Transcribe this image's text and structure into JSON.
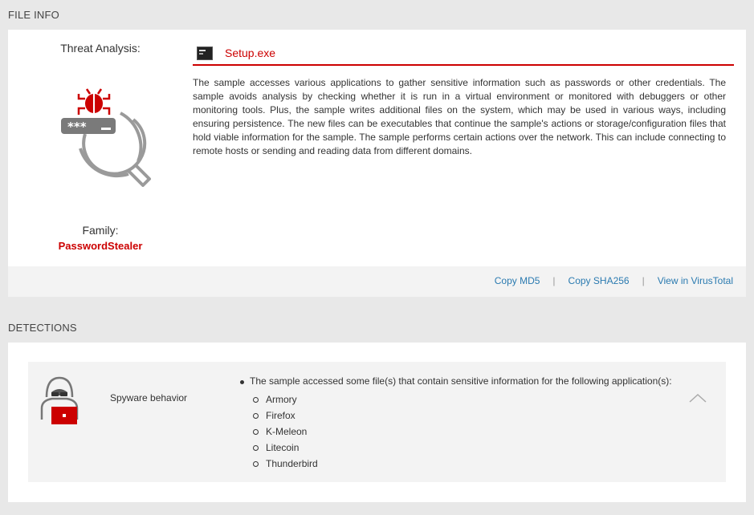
{
  "file_info": {
    "section_title": "FILE INFO",
    "threat_analysis_label": "Threat Analysis:",
    "threat_icon": "password-stealer-icon",
    "family_label": "Family:",
    "family_value": "PasswordStealer",
    "file_icon": "executable-file-icon",
    "file_name": "Setup.exe",
    "description": "The sample accesses various applications to gather sensitive information such as passwords or other credentials. The sample avoids analysis by checking whether it is run in a virtual environment or monitored with debuggers or other monitoring tools. Plus, the sample writes additional files on the system, which may be used in various ways, including ensuring persistence. The new files can be executables that continue the sample's actions or storage/configuration files that hold viable information for the sample. The sample performs certain actions over the network. This can include connecting to remote hosts or sending and reading data from different domains.",
    "footer_links": {
      "copy_md5": "Copy MD5",
      "copy_sha256": "Copy SHA256",
      "view_virustotal": "View in VirusTotal"
    }
  },
  "detections": {
    "section_title": "DETECTIONS",
    "items": [
      {
        "icon": "spyware-hacker-icon",
        "label": "Spyware behavior",
        "summary": "The sample accessed some file(s) that contain sensitive information for the following application(s):",
        "applications": [
          "Armory",
          "Firefox",
          "K-Meleon",
          "Litecoin",
          "Thunderbird"
        ],
        "toggle_icon": "chevron-up-icon"
      }
    ]
  },
  "colors": {
    "accent_red": "#cc0000",
    "link_blue": "#2a7ab0",
    "page_bg": "#e8e8e8",
    "panel_bg": "#ffffff",
    "footer_bg": "#f3f3f3"
  }
}
